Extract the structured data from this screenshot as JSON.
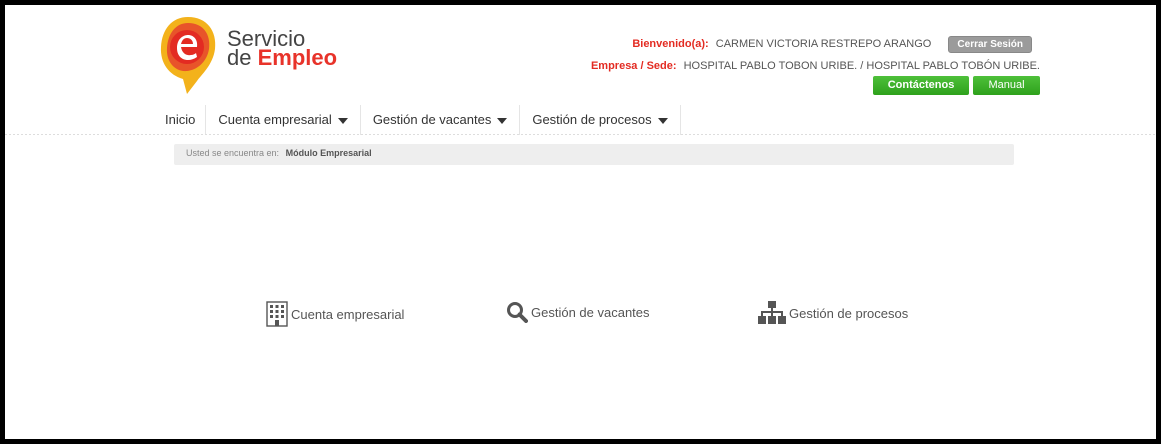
{
  "brand": {
    "logo_letter": "e",
    "line1": "Servicio",
    "line2_prefix": "de ",
    "line2_bold": "Empleo"
  },
  "user": {
    "welcome_label": "Bienvenido(a):",
    "welcome_name": "CARMEN VICTORIA RESTREPO ARANGO",
    "logout_label": "Cerrar Sesión",
    "company_label": "Empresa / Sede:",
    "company_value": "HOSPITAL PABLO TOBON URIBE. / HOSPITAL PABLO TOBÓN URIBE."
  },
  "actions": {
    "contact_label": "Contáctenos",
    "manual_label": "Manual"
  },
  "nav": {
    "items": [
      {
        "label": "Inicio"
      },
      {
        "label": "Cuenta empresarial"
      },
      {
        "label": "Gestión de vacantes"
      },
      {
        "label": "Gestión de procesos"
      }
    ]
  },
  "breadcrumb": {
    "prefix": "Usted se encuentra en:",
    "current": "Módulo Empresarial"
  },
  "shortcuts": [
    {
      "label": "Cuenta empresarial",
      "icon": "building-icon"
    },
    {
      "label": "Gestión de vacantes",
      "icon": "search-icon"
    },
    {
      "label": "Gestión de procesos",
      "icon": "org-chart-icon"
    }
  ],
  "colors": {
    "brand_red": "#e32b22",
    "brand_orange": "#f0a020",
    "action_green": "#35a822",
    "logout_gray": "#9b9b9b"
  }
}
